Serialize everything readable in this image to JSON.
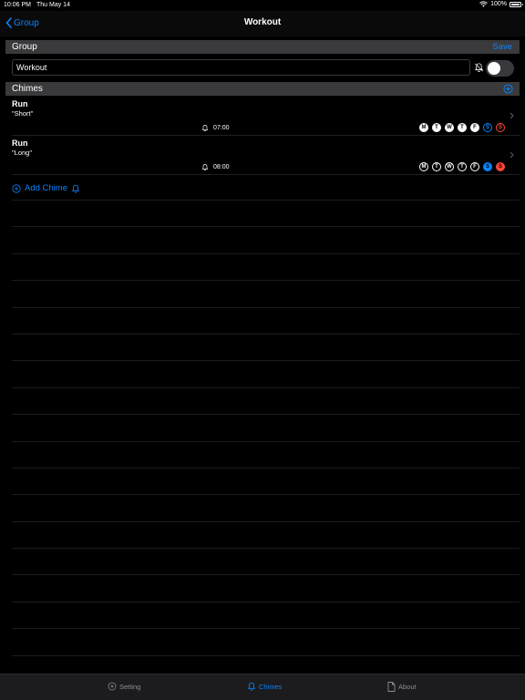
{
  "status_bar": {
    "time": "10:06 PM",
    "date": "Thu May 14",
    "battery": "100%"
  },
  "nav": {
    "back_label": "Group",
    "title": "Workout"
  },
  "group_section": {
    "header": "Group",
    "save_label": "Save",
    "name_value": "Workout",
    "notifications_enabled": false
  },
  "chimes_section": {
    "header": "Chimes"
  },
  "chimes": [
    {
      "title": "Run",
      "sound": "\"Short\"",
      "time": "07:00",
      "days": [
        {
          "letter": "M",
          "style": "filled-white"
        },
        {
          "letter": "T",
          "style": "filled-white"
        },
        {
          "letter": "W",
          "style": "filled-white"
        },
        {
          "letter": "T",
          "style": "filled-white"
        },
        {
          "letter": "F",
          "style": "filled-white"
        },
        {
          "letter": "S",
          "style": "outline-blue"
        },
        {
          "letter": "S",
          "style": "outline-red"
        }
      ]
    },
    {
      "title": "Run",
      "sound": "\"Long\"",
      "time": "08:00",
      "days": [
        {
          "letter": "M",
          "style": "outline-white"
        },
        {
          "letter": "T",
          "style": "outline-white"
        },
        {
          "letter": "W",
          "style": "outline-white"
        },
        {
          "letter": "T",
          "style": "outline-white"
        },
        {
          "letter": "F",
          "style": "outline-white"
        },
        {
          "letter": "S",
          "style": "filled-blue"
        },
        {
          "letter": "S",
          "style": "filled-red"
        }
      ]
    }
  ],
  "add_chime_label": "Add Chime",
  "tabs": [
    {
      "label": "Setting",
      "icon": "gear-icon",
      "active": false
    },
    {
      "label": "Chimes",
      "icon": "bell-icon",
      "active": true
    },
    {
      "label": "About",
      "icon": "document-icon",
      "active": false
    }
  ],
  "colors": {
    "accent": "#0a84ff",
    "weekend_sunday": "#ff453a",
    "header_bg": "#3a3a3c"
  }
}
